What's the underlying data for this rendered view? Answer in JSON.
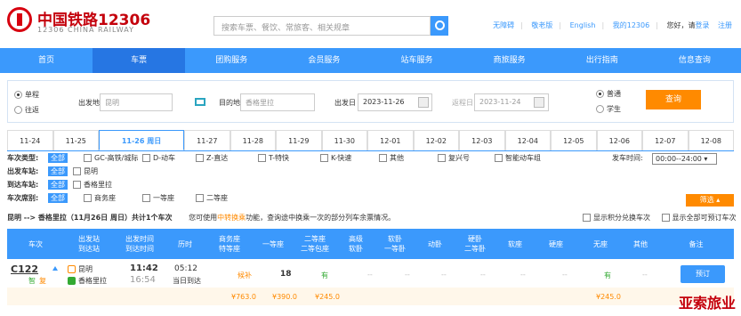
{
  "header": {
    "logo_cn": "中国铁路12306",
    "logo_en": "12306 CHINA RAILWAY",
    "search_placeholder": "搜索车票、餐饮、常旅客、相关规章",
    "links": [
      "无障碍",
      "敬老版",
      "English",
      "我的12306"
    ],
    "hello": "您好，请",
    "login": "登录",
    "register": "注册"
  },
  "nav": [
    "首页",
    "车票",
    "团购服务",
    "会员服务",
    "站车服务",
    "商旅服务",
    "出行指南",
    "信息查询"
  ],
  "form": {
    "oneway": "单程",
    "roundtrip": "往返",
    "from_label": "出发地",
    "from_value": "昆明",
    "to_label": "目的地",
    "to_value": "香格里拉",
    "depart_label": "出发日",
    "depart_value": "2023-11-26",
    "return_label": "返程日",
    "return_value": "2023-11-24",
    "normal": "普通",
    "student": "学生",
    "query": "查询"
  },
  "dates": [
    "11-24",
    "11-25",
    "11-26 周日",
    "11-27",
    "11-28",
    "11-29",
    "11-30",
    "12-01",
    "12-02",
    "12-03",
    "12-04",
    "12-05",
    "12-06",
    "12-07",
    "12-08"
  ],
  "filter": {
    "type_label": "车次类型:",
    "all": "全部",
    "types": [
      "GC-高铁/城际",
      "D-动车",
      "Z-直达",
      "T-特快",
      "K-快速",
      "其他",
      "复兴号",
      "智能动车组"
    ],
    "from_label": "出发车站:",
    "from_station": "昆明",
    "to_label": "到达车站:",
    "to_station": "香格里拉",
    "seat_label": "车次席别:",
    "seats": [
      "商务座",
      "一等座",
      "二等座"
    ],
    "time_label": "发车时间:",
    "time_value": "00:00--24:00",
    "screen": "筛选"
  },
  "summary": {
    "route": "昆明 --> 香格里拉（11月26日 周日）共计1个车次",
    "prefix": "您可使用",
    "transfer": "中转换乘",
    "suffix": "功能，查询途中换乘一次的部分列车余票情况。",
    "cb1": "显示积分兑换车次",
    "cb2": "显示全部可预订车次"
  },
  "table": {
    "headers": [
      "车次",
      "出发站\n到达站",
      "出发时间\n到达时间",
      "历时",
      "商务座\n特等座",
      "一等座",
      "二等座\n二等包座",
      "高级\n软卧",
      "软卧\n一等卧",
      "动卧",
      "硬卧\n二等卧",
      "软座",
      "硬座",
      "无座",
      "其他",
      "备注"
    ],
    "train": {
      "no": "C122",
      "tag1": "智",
      "tag2": "复",
      "from": "昆明",
      "to": "香格里拉",
      "dep": "11:42",
      "arr": "16:54",
      "dur": "05:12",
      "day": "当日到达",
      "business": "候补",
      "first": "18",
      "second": "有",
      "none": "有",
      "dash": "--",
      "book": "预订",
      "p_business": "¥763.0",
      "p_first": "¥390.0",
      "p_second": "¥245.0",
      "p_none": "¥245.0"
    }
  },
  "watermark": "亚索旅业"
}
